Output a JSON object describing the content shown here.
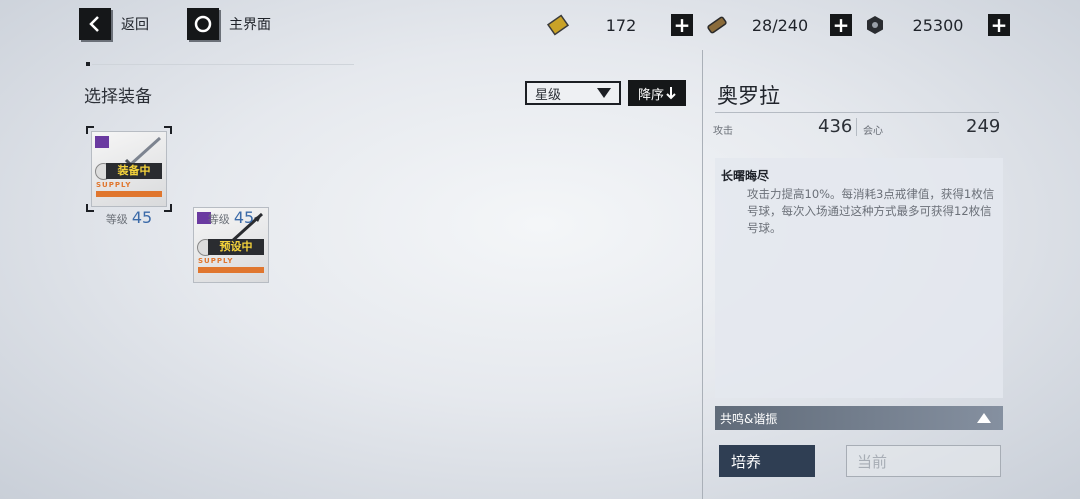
{
  "nav": {
    "back_label": "返回",
    "home_label": "主界面"
  },
  "resources": [
    {
      "icon": "gold-ticket-icon",
      "value": "172"
    },
    {
      "icon": "battery-icon",
      "value": "28/240"
    },
    {
      "icon": "hex-coin-icon",
      "value": "25300"
    }
  ],
  "equipment": {
    "title": "选择装备",
    "sort_value": "星级",
    "order_label": "降序",
    "items": [
      {
        "badge": "装备中",
        "supply": "SUPPLY",
        "level_label": "等级",
        "level": "45"
      },
      {
        "badge": "预设中",
        "supply": "SUPPLY",
        "level_label": "等级",
        "level": "45"
      }
    ]
  },
  "details": {
    "name": "奥罗拉",
    "stats": [
      {
        "label": "攻击",
        "value": "436"
      },
      {
        "label": "会心",
        "value": "249"
      }
    ],
    "skill_name": "长曙晦尽",
    "skill_desc": "攻击力提高10%。每消耗3点戒律值，获得1枚信号球，每次入场通过这种方式最多可获得12枚信号球。",
    "resonance_label": "共鸣&谐振",
    "cultivate_label": "培养",
    "current_label": "当前"
  },
  "colors": {
    "accent_dark": "#151719",
    "level_blue": "#3b6aa8",
    "badge_yellow": "#f5d33b",
    "supply_orange": "#e0762e"
  }
}
